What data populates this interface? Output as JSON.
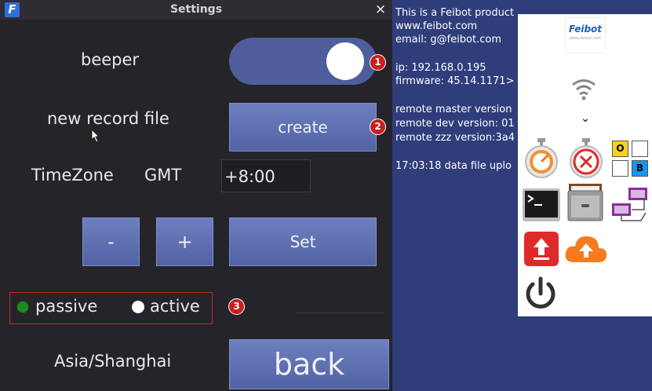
{
  "window": {
    "title": "Settings",
    "app_icon": "F",
    "close_label": "×"
  },
  "beeper": {
    "label": "beeper",
    "enabled": true
  },
  "record": {
    "label": "new record file",
    "button": "create"
  },
  "timezone": {
    "label": "TimeZone",
    "gmt_label": "GMT",
    "offset": "+8:00",
    "minus": "-",
    "plus": "+",
    "set": "Set",
    "region": "Asia/Shanghai"
  },
  "mode": {
    "passive": "passive",
    "active": "active",
    "selected": "passive"
  },
  "back": "back",
  "badges": [
    "1",
    "2",
    "3"
  ],
  "desktop": {
    "lines": [
      "This is a Feibot product",
      "www.feibot.com",
      "email: g@feibot.com",
      "ip: 192.168.0.195",
      "firmware: 45.14.1171>",
      "remote master version",
      "remote dev version: 01",
      "remote zzz version:3a4",
      "17:03:18 data file uplo"
    ]
  },
  "panel": {
    "logo": "Feibot",
    "logo_sub": "www.feibot.com",
    "chevron": "⌄",
    "o_label": "O",
    "b_label": "B",
    "colors": {
      "orange": "#f0922f",
      "red": "#e02a2a",
      "yellow": "#f5d020",
      "blue": "#1793f0"
    }
  },
  "colors": {
    "window_bg": "#252429",
    "button": "#6274b4",
    "desktop": "#2f3d7a",
    "badge": "#c8201e"
  }
}
